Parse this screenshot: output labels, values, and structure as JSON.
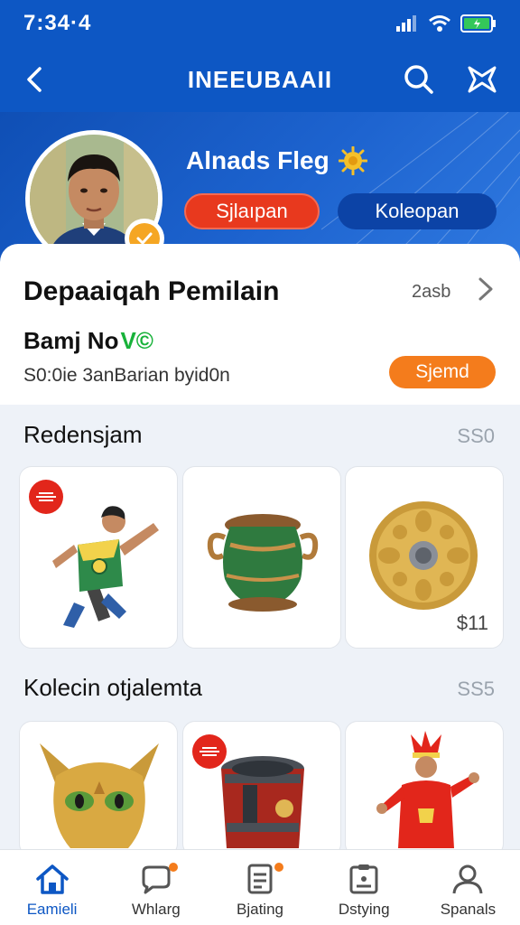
{
  "status_bar": {
    "time": "7:34·4"
  },
  "app_bar": {
    "title": "INEEUBAAII"
  },
  "profile": {
    "name": "Alnads Fleg",
    "primary_button": "Sjlaıpan",
    "secondary_button": "Koleopan"
  },
  "info_card": {
    "title": "Depaaiqah Pemilain",
    "count": "2asb",
    "subtitle_prefix": "Bamj No",
    "subtitle_badge": "V©",
    "description": "S0:0ie 3anBarian byid0n",
    "action_button": "Sjemd"
  },
  "sections": [
    {
      "title": "Redensjam",
      "price": "SS0",
      "items": [
        {
          "name": "warrior-figure",
          "sale": true,
          "price": ""
        },
        {
          "name": "green-vase",
          "sale": false,
          "price": ""
        },
        {
          "name": "golden-disc",
          "sale": false,
          "price": "$11"
        }
      ]
    },
    {
      "title": "Kolecin otjalemta",
      "price": "SS5",
      "items": [
        {
          "name": "golden-mask",
          "sale": false,
          "price": ""
        },
        {
          "name": "drum-barrel",
          "sale": true,
          "price": ""
        },
        {
          "name": "red-dancer",
          "sale": false,
          "price": ""
        }
      ]
    }
  ],
  "bottom_nav": [
    {
      "label": "Eamieli",
      "icon": "home-icon",
      "active": true
    },
    {
      "label": "Whlarg",
      "icon": "chat-icon",
      "active": false
    },
    {
      "label": "Bjating",
      "icon": "document-icon",
      "active": false
    },
    {
      "label": "Dstying",
      "icon": "wallet-icon",
      "active": false
    },
    {
      "label": "Spanals",
      "icon": "profile-icon",
      "active": false
    }
  ],
  "colors": {
    "brand_blue": "#0d57c4",
    "accent_red": "#e8391e",
    "accent_orange": "#f47c1c",
    "accent_green": "#18b23a"
  }
}
